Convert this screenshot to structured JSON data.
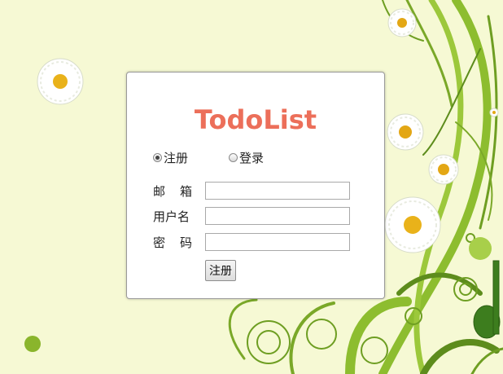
{
  "app": {
    "title": "TodoList"
  },
  "tabs": [
    {
      "label": "注册",
      "selected": true
    },
    {
      "label": "登录",
      "selected": false
    }
  ],
  "form": {
    "email_label_chars": [
      "邮",
      "箱"
    ],
    "username_label": "用户名",
    "password_label_chars": [
      "密",
      "码"
    ],
    "email_value": "",
    "username_value": "",
    "password_value": "",
    "submit_label": "注册"
  },
  "colors": {
    "background": "#f6f9d4",
    "title": "#ec6f5a",
    "vine": "#7fae2a"
  }
}
